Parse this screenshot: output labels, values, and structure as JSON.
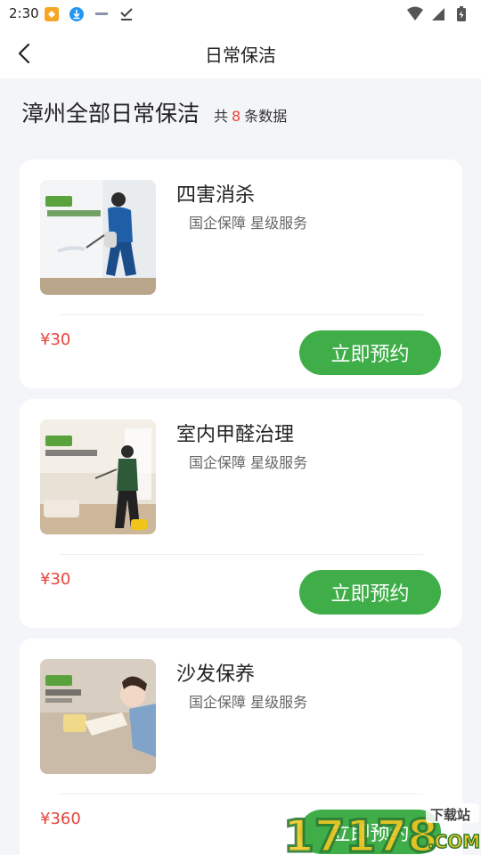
{
  "status_bar": {
    "time": "2:30"
  },
  "nav": {
    "title": "日常保洁"
  },
  "header": {
    "title": "漳州全部日常保洁",
    "count_prefix": "共",
    "count": "8",
    "count_suffix": "条数据"
  },
  "services": [
    {
      "name": "四害消杀",
      "tags": "国企保障 星级服务",
      "price": "¥30",
      "button": "立即预约"
    },
    {
      "name": "室内甲醛治理",
      "tags": "国企保障 星级服务",
      "price": "¥30",
      "button": "立即预约"
    },
    {
      "name": "沙发保养",
      "tags": "国企保障 星级服务",
      "price": "¥360",
      "button": "立即预约"
    }
  ],
  "watermark": {
    "text": "17178",
    "badge": "下载站",
    "suffix": ".COM"
  },
  "colors": {
    "accent_green": "#3fae49",
    "price_red": "#e8443a",
    "background": "#f4f5f9"
  }
}
